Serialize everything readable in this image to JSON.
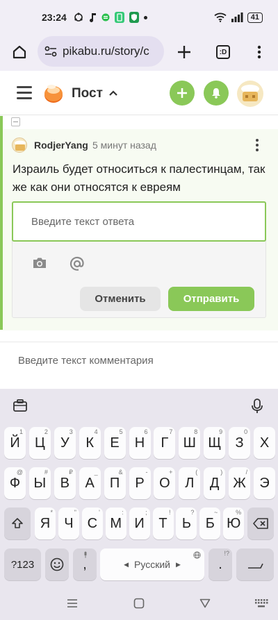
{
  "status_bar": {
    "time": "23:24",
    "battery": "41"
  },
  "browser": {
    "url": "pikabu.ru/story/c",
    "tab_count": ":D"
  },
  "site_header": {
    "title": "Пост"
  },
  "comment": {
    "author": "RodjerYang",
    "time_ago": "5 минут назад",
    "text": "Израиль будет относиться к палестинцам, так же как они относятся к евреям"
  },
  "reply": {
    "placeholder": "Введите текст ответа",
    "cancel_label": "Отменить",
    "send_label": "Отправить"
  },
  "new_comment": {
    "placeholder": "Введите текст комментария"
  },
  "keyboard": {
    "row1": [
      {
        "k": "Й",
        "h": "1"
      },
      {
        "k": "Ц",
        "h": "2"
      },
      {
        "k": "У",
        "h": "3"
      },
      {
        "k": "К",
        "h": "4"
      },
      {
        "k": "Е",
        "h": "5"
      },
      {
        "k": "Н",
        "h": "6"
      },
      {
        "k": "Г",
        "h": "7"
      },
      {
        "k": "Ш",
        "h": "8"
      },
      {
        "k": "Щ",
        "h": "9"
      },
      {
        "k": "З",
        "h": "0"
      },
      {
        "k": "Х",
        "h": ""
      }
    ],
    "row2": [
      {
        "k": "Ф",
        "h": "@"
      },
      {
        "k": "Ы",
        "h": "#"
      },
      {
        "k": "В",
        "h": "₽"
      },
      {
        "k": "А",
        "h": "_"
      },
      {
        "k": "П",
        "h": "&"
      },
      {
        "k": "Р",
        "h": "-"
      },
      {
        "k": "О",
        "h": "+"
      },
      {
        "k": "Л",
        "h": "("
      },
      {
        "k": "Д",
        "h": ")"
      },
      {
        "k": "Ж",
        "h": "/"
      },
      {
        "k": "Э",
        "h": ""
      }
    ],
    "row3": [
      {
        "k": "Я",
        "h": "*"
      },
      {
        "k": "Ч",
        "h": "\""
      },
      {
        "k": "С",
        "h": "'"
      },
      {
        "k": "М",
        "h": ":"
      },
      {
        "k": "И",
        "h": ";"
      },
      {
        "k": "Т",
        "h": "!"
      },
      {
        "k": "Ь",
        "h": "?"
      },
      {
        "k": "Б",
        "h": "~"
      },
      {
        "k": "Ю",
        "h": "%"
      }
    ],
    "symbols_label": "?123",
    "comma": ",",
    "period": ".",
    "period_hint": "!?",
    "space_label": "Русский"
  }
}
